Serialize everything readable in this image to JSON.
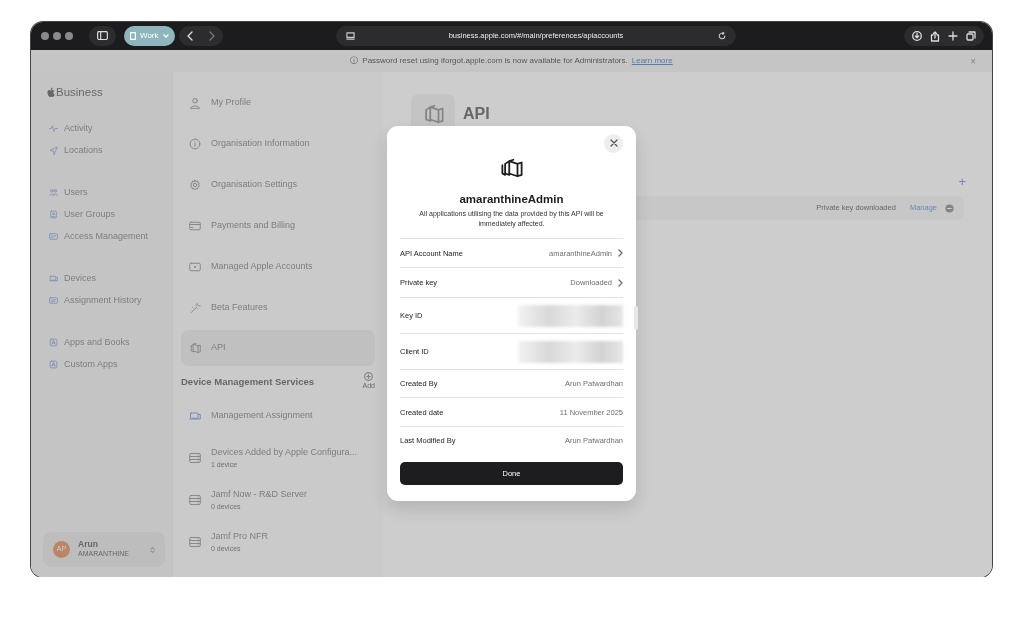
{
  "browser": {
    "tab_group": "Work",
    "address": "business.apple.com/#/main/preferences/apiaccounts"
  },
  "banner": {
    "icon": "ⓘ",
    "text": "Password reset using iforgot.apple.com is now available for Administrators.",
    "link": "Learn more",
    "close": "×"
  },
  "sidebar": {
    "logo": "Business",
    "groups": [
      [
        {
          "label": "Activity"
        },
        {
          "label": "Locations"
        }
      ],
      [
        {
          "label": "Users"
        },
        {
          "label": "User Groups"
        },
        {
          "label": "Access Management"
        }
      ],
      [
        {
          "label": "Devices"
        },
        {
          "label": "Assignment History"
        }
      ],
      [
        {
          "label": "Apps and Books"
        },
        {
          "label": "Custom Apps"
        }
      ]
    ],
    "user": {
      "initials": "AP",
      "name": "Arun",
      "org": "AMARANTHINE"
    }
  },
  "preferences": {
    "items": [
      {
        "label": "My Profile",
        "selected": false
      },
      {
        "label": "Organisation Information",
        "selected": false
      },
      {
        "label": "Organisation Settings",
        "selected": false
      },
      {
        "label": "Payments and Billing",
        "selected": false
      },
      {
        "label": "Managed Apple Accounts",
        "selected": false
      },
      {
        "label": "Beta Features",
        "selected": false
      },
      {
        "label": "API",
        "selected": true
      }
    ],
    "section": {
      "title": "Device Management Services",
      "add_label": "Add"
    },
    "servers": [
      {
        "label": "Management Assignment"
      },
      {
        "label": "Devices Added by Apple Configura...",
        "subtitle": "1 device"
      },
      {
        "label": "Jamf Now - R&D Server",
        "subtitle": "0 devices"
      },
      {
        "label": "Jamf Pro NFR",
        "subtitle": "0 devices"
      }
    ]
  },
  "content": {
    "title": "API",
    "add": "+",
    "status": "Private key downloaded",
    "manage": "Manage"
  },
  "dialog": {
    "title": "amaranthineAdmin",
    "message": "All applications utilising the data provided by this API will be immediately affected.",
    "rows": [
      {
        "label": "API Account Name",
        "value": "amaranthineAdmin",
        "chevron": true,
        "redacted": false
      },
      {
        "label": "Private key",
        "value": "Downloaded",
        "chevron": true,
        "redacted": false
      },
      {
        "label": "Key ID",
        "redacted": true,
        "chevron": false
      },
      {
        "label": "Client ID",
        "redacted": true,
        "chevron": false
      },
      {
        "label": "Created By",
        "value": "Arun Patwardhan",
        "chevron": false,
        "redacted": false
      },
      {
        "label": "Created date",
        "value": "11 November 2025",
        "chevron": false,
        "redacted": false
      },
      {
        "label": "Last Modified By",
        "value": "Arun Patwardhan",
        "chevron": false,
        "redacted": false
      }
    ],
    "button": "Done"
  }
}
